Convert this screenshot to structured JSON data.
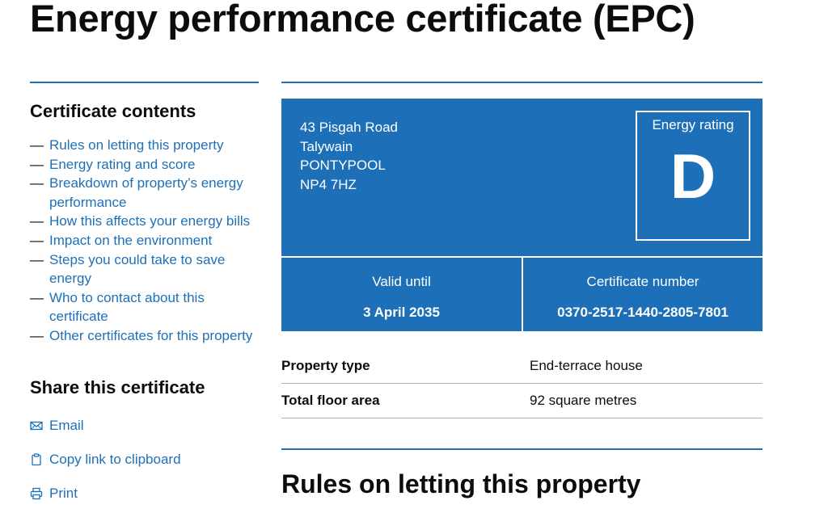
{
  "page": {
    "title": "Energy performance certificate (EPC)"
  },
  "sidebar": {
    "contents_heading": "Certificate contents",
    "dash": "—",
    "items": [
      {
        "label": "Rules on letting this property"
      },
      {
        "label": "Energy rating and score"
      },
      {
        "label": "Breakdown of property’s energy performance"
      },
      {
        "label": "How this affects your energy bills"
      },
      {
        "label": "Impact on the environment"
      },
      {
        "label": "Steps you could take to save energy"
      },
      {
        "label": "Who to contact about this certificate"
      },
      {
        "label": "Other certificates for this property"
      }
    ],
    "share_heading": "Share this certificate",
    "share_items": [
      {
        "label": "Email",
        "icon": "envelope-icon"
      },
      {
        "label": "Copy link to clipboard",
        "icon": "clipboard-icon"
      },
      {
        "label": "Print",
        "icon": "printer-icon"
      }
    ]
  },
  "certificate": {
    "address": [
      "43 Pisgah Road",
      "Talywain",
      "PONTYPOOL",
      "NP4 7HZ"
    ],
    "energy_rating_label": "Energy rating",
    "energy_rating": "D",
    "valid_until_label": "Valid until",
    "valid_until": "3 April 2035",
    "certificate_number_label": "Certificate number",
    "certificate_number": "0370-2517-1440-2805-7801"
  },
  "summary": [
    {
      "key": "Property type",
      "value": "End-terrace house"
    },
    {
      "key": "Total floor area",
      "value": "92 square metres"
    }
  ],
  "section": {
    "heading": "Rules on letting this property"
  },
  "colors": {
    "brand_blue": "#1d70b8",
    "text": "#0b0c0c",
    "border_grey": "#b1b4b6"
  }
}
